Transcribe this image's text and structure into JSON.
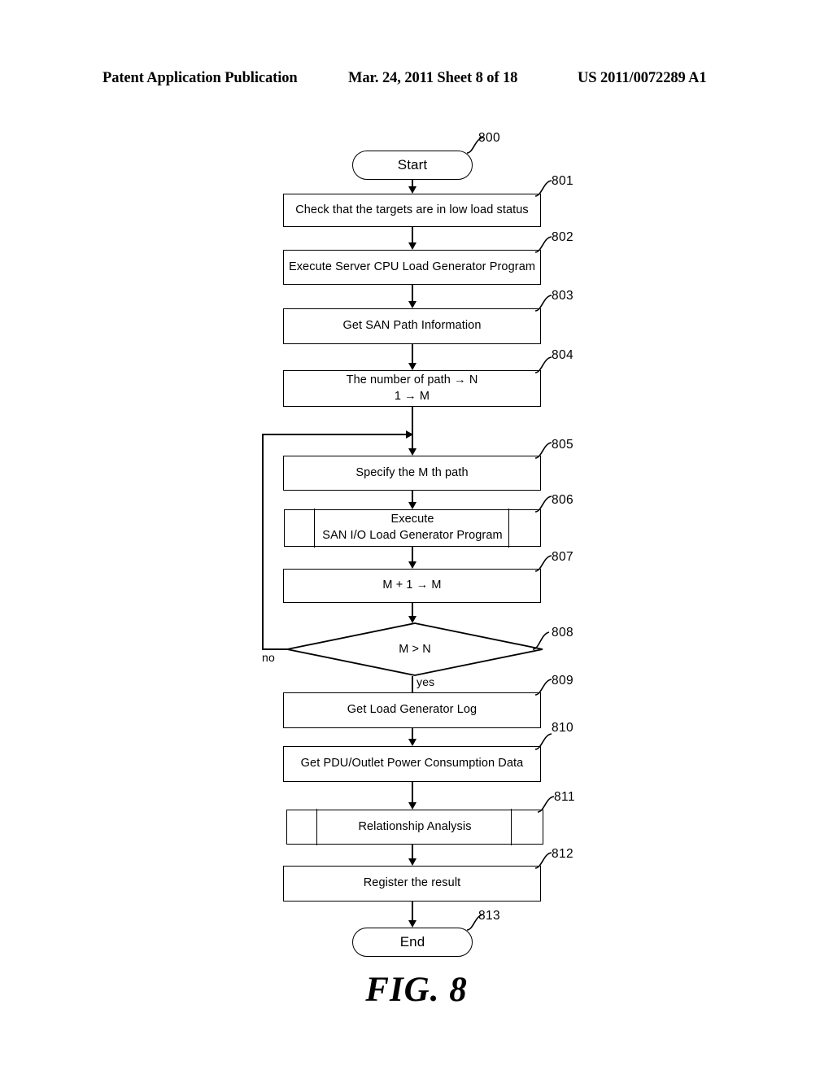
{
  "header": {
    "publication": "Patent Application Publication",
    "date_sheet": "Mar. 24, 2011  Sheet 8 of 18",
    "patent_number": "US 2011/0072289 A1"
  },
  "figure": {
    "caption": "FIG. 8"
  },
  "flowchart": {
    "nodes": [
      {
        "ref": "800",
        "shape": "terminator",
        "text": "Start"
      },
      {
        "ref": "801",
        "shape": "process",
        "text": "Check that the targets are in low load status"
      },
      {
        "ref": "802",
        "shape": "process",
        "text": "Execute Server CPU Load Generator Program"
      },
      {
        "ref": "803",
        "shape": "process",
        "text": "Get SAN Path Information"
      },
      {
        "ref": "804",
        "shape": "process",
        "line1": "The number of path → N",
        "line2": "1 → M"
      },
      {
        "ref": "805",
        "shape": "process",
        "text": "Specify the M th path"
      },
      {
        "ref": "806",
        "shape": "predefined",
        "line1": "Execute",
        "line2": "SAN I/O Load Generator Program"
      },
      {
        "ref": "807",
        "shape": "process",
        "text": "M + 1 → M"
      },
      {
        "ref": "808",
        "shape": "decision",
        "text": "M > N"
      },
      {
        "ref": "809",
        "shape": "process",
        "text": "Get Load Generator Log"
      },
      {
        "ref": "810",
        "shape": "process",
        "text": "Get PDU/Outlet Power Consumption Data"
      },
      {
        "ref": "811",
        "shape": "predefined",
        "text": "Relationship  Analysis"
      },
      {
        "ref": "812",
        "shape": "process",
        "text": "Register the result"
      },
      {
        "ref": "813",
        "shape": "terminator",
        "text": "End"
      }
    ],
    "branches": {
      "no": "no",
      "yes": "yes"
    }
  },
  "colors": {
    "ink": "#000000",
    "paper": "#ffffff"
  }
}
